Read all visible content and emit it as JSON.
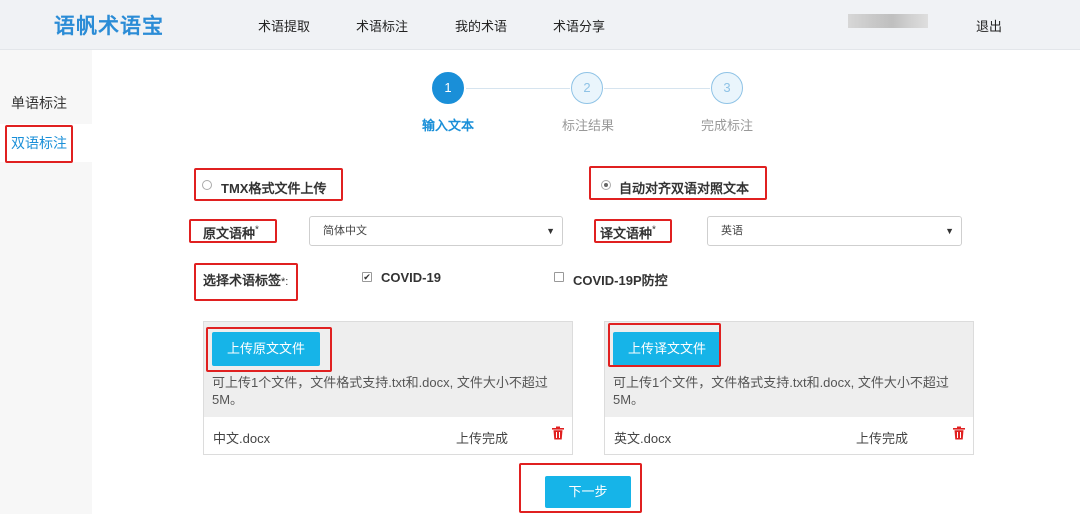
{
  "header": {
    "logo": "语帆术语宝",
    "nav": [
      "术语提取",
      "术语标注",
      "我的术语",
      "术语分享"
    ],
    "logout": "退出"
  },
  "sidebar": {
    "items": [
      {
        "label": "单语标注",
        "active": false
      },
      {
        "label": "双语标注",
        "active": true
      }
    ]
  },
  "steps": [
    {
      "number": "1",
      "label": "输入文本",
      "state": "active"
    },
    {
      "number": "2",
      "label": "标注结果",
      "state": "todo"
    },
    {
      "number": "3",
      "label": "完成标注",
      "state": "todo"
    }
  ],
  "upload_mode": {
    "options": [
      {
        "label": "TMX格式文件上传",
        "checked": false
      },
      {
        "label": "自动对齐双语对照文本",
        "checked": true
      }
    ]
  },
  "source_lang": {
    "label": "原文语种",
    "required_mark": "*",
    "value": "简体中文"
  },
  "target_lang": {
    "label": "译文语种",
    "required_mark": "*",
    "value": "英语"
  },
  "tags": {
    "label": "选择术语标签",
    "required_mark": "*:",
    "options": [
      {
        "label": "COVID-19",
        "checked": true
      },
      {
        "label": "COVID-19P防控",
        "checked": false
      }
    ]
  },
  "source_upload": {
    "button": "上传原文文件",
    "hint": "可上传1个文件，文件格式支持.txt和.docx, 文件大小不超过5M。",
    "file_name": "中文.docx",
    "status": "上传完成"
  },
  "target_upload": {
    "button": "上传译文文件",
    "hint": "可上传1个文件，文件格式支持.txt和.docx, 文件大小不超过5M。",
    "file_name": "英文.docx",
    "status": "上传完成"
  },
  "next_button": "下一步",
  "colors": {
    "accent": "#1a8fd8",
    "button": "#16b4e8",
    "highlight_box": "#e02020",
    "trash": "#e02020"
  },
  "icons": {
    "select_arrow": "chevron-down-icon",
    "delete": "trash-icon",
    "checkbox_checked": "check-icon"
  }
}
